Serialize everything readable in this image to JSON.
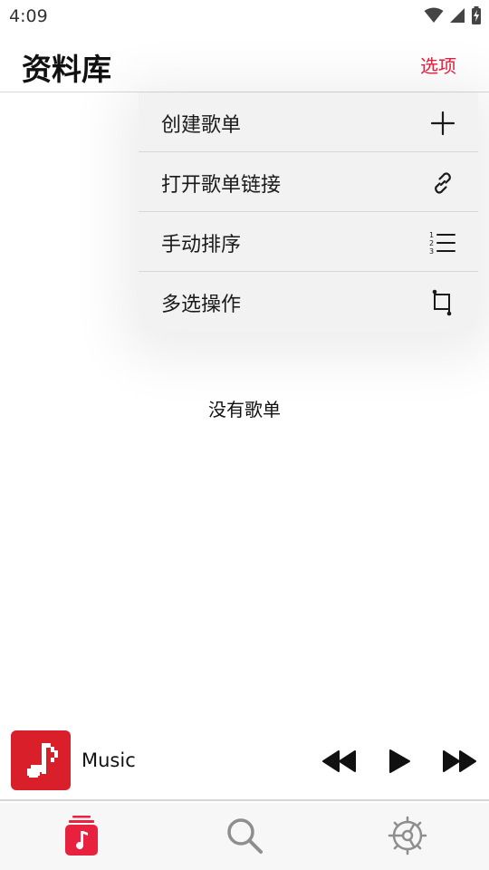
{
  "status_bar": {
    "time": "4:09",
    "icons": [
      "wifi-icon",
      "signal-icon",
      "battery-charging-icon"
    ]
  },
  "header": {
    "title": "资料库",
    "options_label": "选项"
  },
  "menu": {
    "items": [
      {
        "label": "创建歌单",
        "icon": "plus-icon"
      },
      {
        "label": "打开歌单链接",
        "icon": "link-icon"
      },
      {
        "label": "手动排序",
        "icon": "numbered-list-icon"
      },
      {
        "label": "多选操作",
        "icon": "select-crop-icon"
      }
    ]
  },
  "main": {
    "empty_text": "没有歌单"
  },
  "player": {
    "title": "Music",
    "art_icon": "music-note-icon",
    "controls": [
      "rewind-icon",
      "play-icon",
      "fast-forward-icon"
    ]
  },
  "tabs": [
    {
      "name": "library",
      "icon": "library-icon",
      "active": true
    },
    {
      "name": "search",
      "icon": "search-icon",
      "active": false
    },
    {
      "name": "settings",
      "icon": "settings-icon",
      "active": false
    }
  ],
  "colors": {
    "accent": "#e8213f",
    "album_art": "#d81f2a",
    "menu_bg": "#f2f2f2",
    "inactive_tab": "#8e8e8e"
  }
}
